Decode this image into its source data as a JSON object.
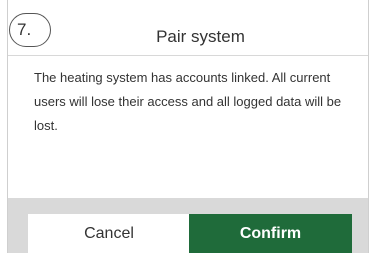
{
  "dialog": {
    "step_badge": "7.",
    "title": "Pair system",
    "message": "The heating system has accounts linked. All current users will lose their access and all logged data will be lost.",
    "cancel_label": "Cancel",
    "confirm_label": "Confirm"
  },
  "colors": {
    "confirm_bg": "#1f6b3a",
    "footer_bg": "#d9d9d9"
  }
}
